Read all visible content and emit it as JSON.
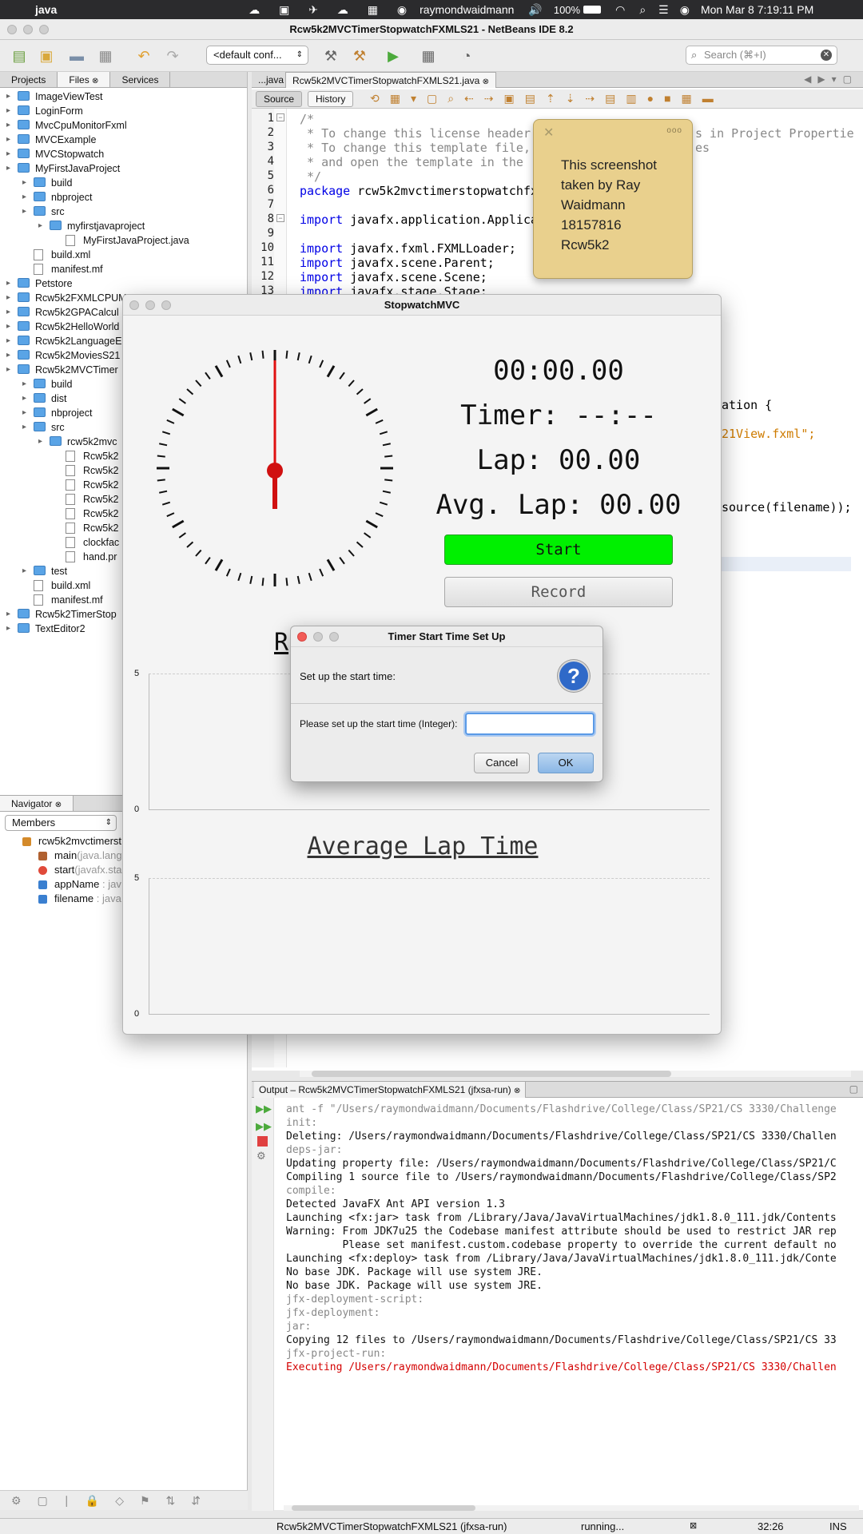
{
  "menubar": {
    "app": "java",
    "user": "raymondwaidmann",
    "battery": "100%",
    "clock": "Mon Mar 8  7:19:11 PM"
  },
  "window_title": "Rcw5k2MVCTimerStopwatchFXMLS21 - NetBeans IDE 8.2",
  "toolbar": {
    "config": "<default conf...",
    "search_placeholder": "Search (⌘+I)"
  },
  "left_panel": {
    "tabs": [
      "Projects",
      "Files",
      "Services"
    ],
    "tree": [
      {
        "label": "ImageViewTest",
        "indent": 0,
        "icon": "folder"
      },
      {
        "label": "LoginForm",
        "indent": 0,
        "icon": "folder"
      },
      {
        "label": "MvcCpuMonitorFxml",
        "indent": 0,
        "icon": "folder"
      },
      {
        "label": "MVCExample",
        "indent": 0,
        "icon": "folder"
      },
      {
        "label": "MVCStopwatch",
        "indent": 0,
        "icon": "folder"
      },
      {
        "label": "MyFirstJavaProject",
        "indent": 0,
        "icon": "folder"
      },
      {
        "label": "build",
        "indent": 1,
        "icon": "folder"
      },
      {
        "label": "nbproject",
        "indent": 1,
        "icon": "folder"
      },
      {
        "label": "src",
        "indent": 1,
        "icon": "folder"
      },
      {
        "label": "myfirstjavaproject",
        "indent": 2,
        "icon": "folder"
      },
      {
        "label": "MyFirstJavaProject.java",
        "indent": 3,
        "icon": "file"
      },
      {
        "label": "build.xml",
        "indent": 1,
        "icon": "file"
      },
      {
        "label": "manifest.mf",
        "indent": 1,
        "icon": "file"
      },
      {
        "label": "Petstore",
        "indent": 0,
        "icon": "folder"
      },
      {
        "label": "Rcw5k2FXMLCPUM",
        "indent": 0,
        "icon": "folder"
      },
      {
        "label": "Rcw5k2GPACalcul",
        "indent": 0,
        "icon": "folder"
      },
      {
        "label": "Rcw5k2HelloWorld",
        "indent": 0,
        "icon": "folder"
      },
      {
        "label": "Rcw5k2LanguageE",
        "indent": 0,
        "icon": "folder"
      },
      {
        "label": "Rcw5k2MoviesS21",
        "indent": 0,
        "icon": "folder"
      },
      {
        "label": "Rcw5k2MVCTimer",
        "indent": 0,
        "icon": "folder"
      },
      {
        "label": "build",
        "indent": 1,
        "icon": "folder"
      },
      {
        "label": "dist",
        "indent": 1,
        "icon": "folder"
      },
      {
        "label": "nbproject",
        "indent": 1,
        "icon": "folder"
      },
      {
        "label": "src",
        "indent": 1,
        "icon": "folder"
      },
      {
        "label": "rcw5k2mvc",
        "indent": 2,
        "icon": "folder"
      },
      {
        "label": "Rcw5k2",
        "indent": 3,
        "icon": "file"
      },
      {
        "label": "Rcw5k2",
        "indent": 3,
        "icon": "file"
      },
      {
        "label": "Rcw5k2",
        "indent": 3,
        "icon": "file"
      },
      {
        "label": "Rcw5k2",
        "indent": 3,
        "icon": "file"
      },
      {
        "label": "Rcw5k2",
        "indent": 3,
        "icon": "file"
      },
      {
        "label": "Rcw5k2",
        "indent": 3,
        "icon": "file"
      },
      {
        "label": "clockfac",
        "indent": 3,
        "icon": "file"
      },
      {
        "label": "hand.pr",
        "indent": 3,
        "icon": "file"
      },
      {
        "label": "test",
        "indent": 1,
        "icon": "folder"
      },
      {
        "label": "build.xml",
        "indent": 1,
        "icon": "file"
      },
      {
        "label": "manifest.mf",
        "indent": 1,
        "icon": "file"
      },
      {
        "label": "Rcw5k2TimerStop",
        "indent": 0,
        "icon": "folder"
      },
      {
        "label": "TextEditor2",
        "indent": 0,
        "icon": "folder"
      }
    ]
  },
  "navigator": {
    "title": "Navigator",
    "filter": "Members",
    "items": [
      {
        "label": "rcw5k2mvctimerst",
        "extra": ""
      },
      {
        "label": "main",
        "extra": "(java.lang"
      },
      {
        "label": "start",
        "extra": "(javafx.sta"
      },
      {
        "label": "appName",
        "extra": " : jav"
      },
      {
        "label": "filename",
        "extra": " : java"
      }
    ]
  },
  "editor": {
    "tabs": [
      "...java",
      "Rcw5k2MVCTimerStopwatchFXMLS21.java"
    ],
    "subtabs": [
      "Source",
      "History"
    ],
    "line_numbers": [
      "1",
      "2",
      "3",
      "4",
      "5",
      "6",
      "7",
      "8",
      "9",
      "10",
      "11",
      "12",
      "13"
    ],
    "lines": [
      {
        "t": "/*",
        "c": "cmt"
      },
      {
        "t": " * To change this license header",
        "c": "cmt",
        "tail": "s in Project Propertie"
      },
      {
        "t": " * To change this template file,",
        "c": "cmt",
        "tail": "es"
      },
      {
        "t": " * and open the template in the",
        "c": "cmt"
      },
      {
        "t": " */",
        "c": "cmt"
      },
      {
        "t": "package rcw5k2mvctimerstopwatchfx",
        "c": "kwfirst"
      },
      {
        "t": "",
        "c": ""
      },
      {
        "t": "import javafx.application.Applica",
        "c": "kwfirst"
      },
      {
        "t": "",
        "c": ""
      },
      {
        "t": "import javafx.fxml.FXMLLoader;",
        "c": "kwfirst"
      },
      {
        "t": "import javafx.scene.Parent;",
        "c": "kwfirst"
      },
      {
        "t": "import javafx.scene.Scene;",
        "c": "kwfirst"
      },
      {
        "t": "import javafx.stage.Stage;",
        "c": "kwfirst"
      }
    ],
    "right_fragments": {
      "a": "ation {",
      "b": "21View.fxml\";",
      "c": "source(filename));"
    }
  },
  "sticky_note": {
    "lines": [
      "This screenshot",
      "taken by Ray",
      "Waidmann",
      "18157816",
      "Rcw5k2"
    ]
  },
  "stopwatch": {
    "title": "StopwatchMVC",
    "time": "00:00.00",
    "timer": "Timer: --:--",
    "lap": "Lap: 00.00",
    "avg_lap": "Avg. Lap: 00.00",
    "start_label": "Start",
    "record_label": "Record",
    "chart1_partial_title": "R",
    "chart2_title": "Average Lap Time",
    "axis_top": "5",
    "axis_bottom": "0",
    "start_color": "#00f000"
  },
  "dialog": {
    "title": "Timer Start Time Set Up",
    "heading": "Set up the start time:",
    "prompt": "Please set up the start time (Integer):",
    "value": "",
    "cancel": "Cancel",
    "ok": "OK"
  },
  "output": {
    "title": "Output – Rcw5k2MVCTimerStopwatchFXMLS21 (jfxsa-run)",
    "lines": [
      {
        "t": "ant -f \"/Users/raymondwaidmann/Documents/Flashdrive/College/Class/SP21/CS 3330/Challenge",
        "c": "ogray"
      },
      {
        "t": "init:",
        "c": "ogray"
      },
      {
        "t": "Deleting: /Users/raymondwaidmann/Documents/Flashdrive/College/Class/SP21/CS 3330/Challen",
        "c": ""
      },
      {
        "t": "deps-jar:",
        "c": "ogray"
      },
      {
        "t": "Updating property file: /Users/raymondwaidmann/Documents/Flashdrive/College/Class/SP21/C",
        "c": ""
      },
      {
        "t": "Compiling 1 source file to /Users/raymondwaidmann/Documents/Flashdrive/College/Class/SP2",
        "c": ""
      },
      {
        "t": "compile:",
        "c": "ogray"
      },
      {
        "t": "Detected JavaFX Ant API version 1.3",
        "c": ""
      },
      {
        "t": "Launching <fx:jar> task from /Library/Java/JavaVirtualMachines/jdk1.8.0_111.jdk/Contents",
        "c": ""
      },
      {
        "t": "Warning: From JDK7u25 the Codebase manifest attribute should be used to restrict JAR rep",
        "c": ""
      },
      {
        "t": "         Please set manifest.custom.codebase property to override the current default no",
        "c": ""
      },
      {
        "t": "Launching <fx:deploy> task from /Library/Java/JavaVirtualMachines/jdk1.8.0_111.jdk/Conte",
        "c": ""
      },
      {
        "t": "No base JDK. Package will use system JRE.",
        "c": ""
      },
      {
        "t": "No base JDK. Package will use system JRE.",
        "c": ""
      },
      {
        "t": "jfx-deployment-script:",
        "c": "ogray"
      },
      {
        "t": "jfx-deployment:",
        "c": "ogray"
      },
      {
        "t": "jar:",
        "c": "ogray"
      },
      {
        "t": "Copying 12 files to /Users/raymondwaidmann/Documents/Flashdrive/College/Class/SP21/CS 33",
        "c": ""
      },
      {
        "t": "jfx-project-run:",
        "c": "ogray"
      },
      {
        "t": "Executing /Users/raymondwaidmann/Documents/Flashdrive/College/Class/SP21/CS 3330/Challen",
        "c": "ored"
      }
    ]
  },
  "status": {
    "project": "Rcw5k2MVCTimerStopwatchFXMLS21 (jfxsa-run)",
    "state": "running...",
    "position": "32:26",
    "mode": "INS"
  }
}
